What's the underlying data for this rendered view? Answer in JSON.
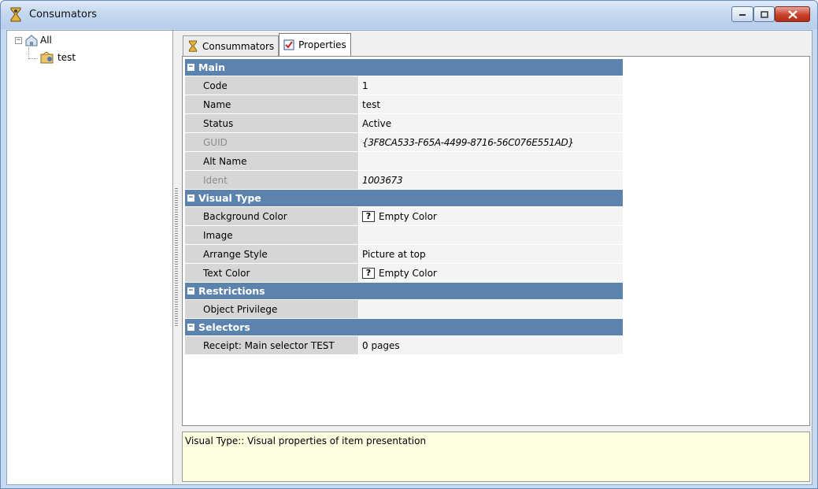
{
  "window": {
    "title": "Consumators",
    "icon": "person-hourglass-icon",
    "controls": {
      "minimize": "minimize-icon",
      "maximize": "maximize-icon",
      "close": "close-icon"
    }
  },
  "tree": {
    "root": {
      "label": "All",
      "expanded_glyph": "−"
    },
    "children": [
      {
        "label": "test"
      }
    ]
  },
  "tabs": [
    {
      "label": "Consummators",
      "active": false
    },
    {
      "label": "Properties",
      "active": true
    }
  ],
  "property_grid": {
    "categories": [
      {
        "title": "Main",
        "rows": [
          {
            "name": "Code",
            "value": "1"
          },
          {
            "name": "Name",
            "value": "test"
          },
          {
            "name": "Status",
            "value": "Active"
          },
          {
            "name": "GUID",
            "value": "{3F8CA533-F65A-4499-8716-56C076E551AD}"
          },
          {
            "name": "Alt Name",
            "value": ""
          },
          {
            "name": "Ident",
            "value": "1003673"
          }
        ]
      },
      {
        "title": "Visual Type",
        "rows": [
          {
            "name": "Background Color",
            "value": "Empty Color"
          },
          {
            "name": "Image",
            "value": ""
          },
          {
            "name": "Arrange Style",
            "value": "Picture at top"
          },
          {
            "name": "Text Color",
            "value": "Empty Color"
          }
        ]
      },
      {
        "title": "Restrictions",
        "rows": [
          {
            "name": "Object Privilege",
            "value": ""
          }
        ]
      },
      {
        "title": "Selectors",
        "rows": [
          {
            "name": "Receipt: Main selector TEST",
            "value": "0 pages"
          }
        ]
      }
    ]
  },
  "description": "Visual Type:: Visual properties of item presentation",
  "colors": {
    "category_header": "#5c83ad",
    "description_bg": "#fdfde0",
    "name_cell": "#d6d6d6"
  }
}
